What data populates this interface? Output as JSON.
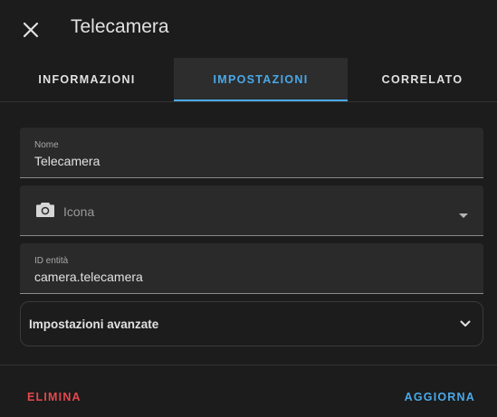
{
  "dialog": {
    "title": "Telecamera",
    "close_icon": "close-icon"
  },
  "tabs": [
    {
      "label": "INFORMAZIONI",
      "active": false
    },
    {
      "label": "IMPOSTAZIONI",
      "active": true
    },
    {
      "label": "CORRELATO",
      "active": false
    }
  ],
  "form": {
    "name": {
      "label": "Nome",
      "value": "Telecamera"
    },
    "icon": {
      "placeholder": "Icona",
      "icon": "camera-icon"
    },
    "entity_id": {
      "label": "ID entità",
      "value": "camera.telecamera"
    },
    "advanced": {
      "label": "Impostazioni avanzate"
    }
  },
  "footer": {
    "delete_label": "ELIMINA",
    "update_label": "AGGIORNA"
  },
  "colors": {
    "background": "#1c1c1c",
    "accent": "#4aa8e8",
    "danger": "#e5484d",
    "field_background": "#2a2a2a"
  }
}
